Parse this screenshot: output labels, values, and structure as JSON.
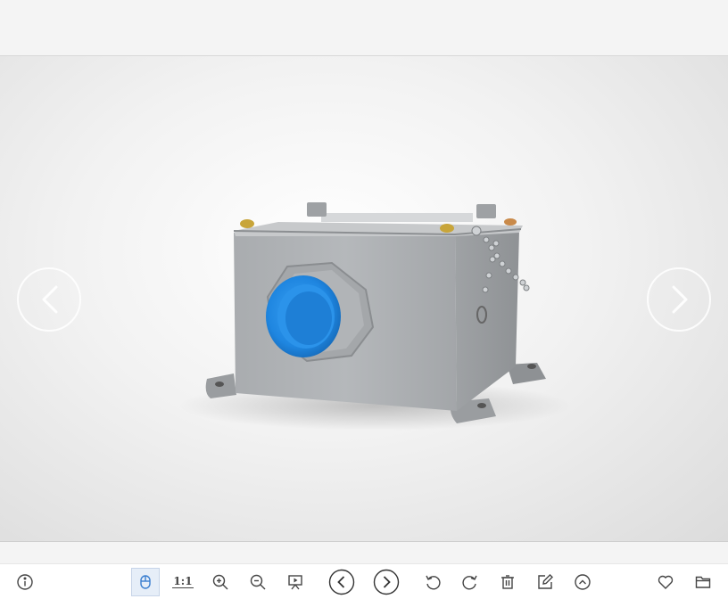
{
  "toolbar": {
    "actual_size_label": "1:1",
    "icons": [
      "info-icon",
      "mouse-icon",
      "ratio-icon",
      "zoom-in-icon",
      "zoom-out-icon",
      "slideshow-icon",
      "previous-icon",
      "next-icon",
      "rotate-left-icon",
      "rotate-right-icon",
      "trash-icon",
      "edit-icon",
      "expand-up-icon",
      "heart-icon",
      "folder-icon"
    ]
  },
  "viewer": {
    "nav_prev_icon": "chevron-left-icon",
    "nav_next_icon": "chevron-right-icon"
  },
  "colors": {
    "toolbar_bg": "#ffffff",
    "active_button_bg": "#e6eef8",
    "icon_color": "#444444",
    "plug_blue": "#2f8fe0"
  }
}
